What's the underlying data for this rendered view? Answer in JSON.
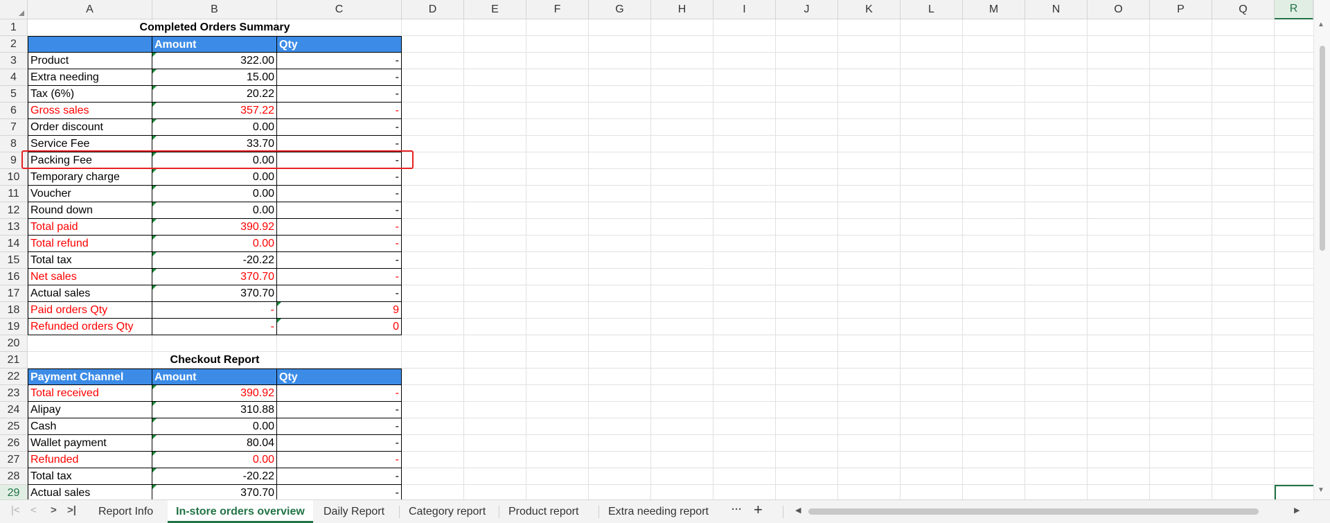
{
  "grid": {
    "columns": [
      "A",
      "B",
      "C",
      "D",
      "E",
      "F",
      "G",
      "H",
      "I",
      "J",
      "K",
      "L",
      "M",
      "N",
      "O",
      "P",
      "Q",
      "R"
    ],
    "rows": [
      "1",
      "2",
      "3",
      "4",
      "5",
      "6",
      "7",
      "8",
      "9",
      "10",
      "11",
      "12",
      "13",
      "14",
      "15",
      "16",
      "17",
      "18",
      "19",
      "20",
      "21",
      "22",
      "23",
      "24",
      "25",
      "26",
      "27",
      "28",
      "29"
    ],
    "selected_column": "R",
    "selected_row": "29"
  },
  "summary_table": {
    "title": "Completed Orders Summary",
    "headers": [
      "",
      "Amount",
      "Qty"
    ],
    "rows": [
      {
        "label": "Product",
        "amount": "322.00",
        "qty": "-",
        "red": false
      },
      {
        "label": "Extra needing",
        "amount": "15.00",
        "qty": "-",
        "red": false
      },
      {
        "label": "Tax (6%)",
        "amount": "20.22",
        "qty": "-",
        "red": false
      },
      {
        "label": "Gross sales",
        "amount": "357.22",
        "qty": "-",
        "red": true
      },
      {
        "label": "Order discount",
        "amount": "0.00",
        "qty": "-",
        "red": false
      },
      {
        "label": "Service Fee",
        "amount": "33.70",
        "qty": "-",
        "red": false
      },
      {
        "label": "Packing Fee",
        "amount": "0.00",
        "qty": "-",
        "red": false
      },
      {
        "label": "Temporary charge",
        "amount": "0.00",
        "qty": "-",
        "red": false
      },
      {
        "label": "Voucher",
        "amount": "0.00",
        "qty": "-",
        "red": false
      },
      {
        "label": "Round down",
        "amount": "0.00",
        "qty": "-",
        "red": false
      },
      {
        "label": "Total paid",
        "amount": "390.92",
        "qty": "-",
        "red": true
      },
      {
        "label": "Total refund",
        "amount": "0.00",
        "qty": "-",
        "red": true
      },
      {
        "label": "Total tax",
        "amount": "-20.22",
        "qty": "-",
        "red": false
      },
      {
        "label": "Net sales",
        "amount": "370.70",
        "qty": "-",
        "red": true
      },
      {
        "label": "Actual sales",
        "amount": "370.70",
        "qty": "-",
        "red": false
      },
      {
        "label": "Paid orders Qty",
        "amount": "-",
        "qty": "9",
        "red": true
      },
      {
        "label": "Refunded orders Qty",
        "amount": "-",
        "qty": "0",
        "red": true
      }
    ]
  },
  "checkout_table": {
    "title": "Checkout Report",
    "headers": [
      "Payment Channel",
      "Amount",
      "Qty"
    ],
    "rows": [
      {
        "label": "Total received",
        "amount": "390.92",
        "qty": "-",
        "red": true
      },
      {
        "label": "Alipay",
        "amount": "310.88",
        "qty": "-",
        "red": false
      },
      {
        "label": "Cash",
        "amount": "0.00",
        "qty": "-",
        "red": false
      },
      {
        "label": "Wallet payment",
        "amount": "80.04",
        "qty": "-",
        "red": false
      },
      {
        "label": "Refunded",
        "amount": "0.00",
        "qty": "-",
        "red": true
      },
      {
        "label": "Total tax",
        "amount": "-20.22",
        "qty": "-",
        "red": false
      },
      {
        "label": "Actual sales",
        "amount": "370.70",
        "qty": "-",
        "red": false
      }
    ]
  },
  "sheet_tabs": {
    "tabs": [
      "Report Info",
      "In-store orders overview",
      "Daily Report",
      "Category report",
      "Product report",
      "Extra needing report"
    ],
    "active": "In-store orders overview",
    "more_label": "···",
    "add_label": "+"
  },
  "colors": {
    "header_fill": "#3c8ce7",
    "red_text": "#ff0000",
    "accent": "#217346",
    "highlight_box": "#e82020"
  }
}
